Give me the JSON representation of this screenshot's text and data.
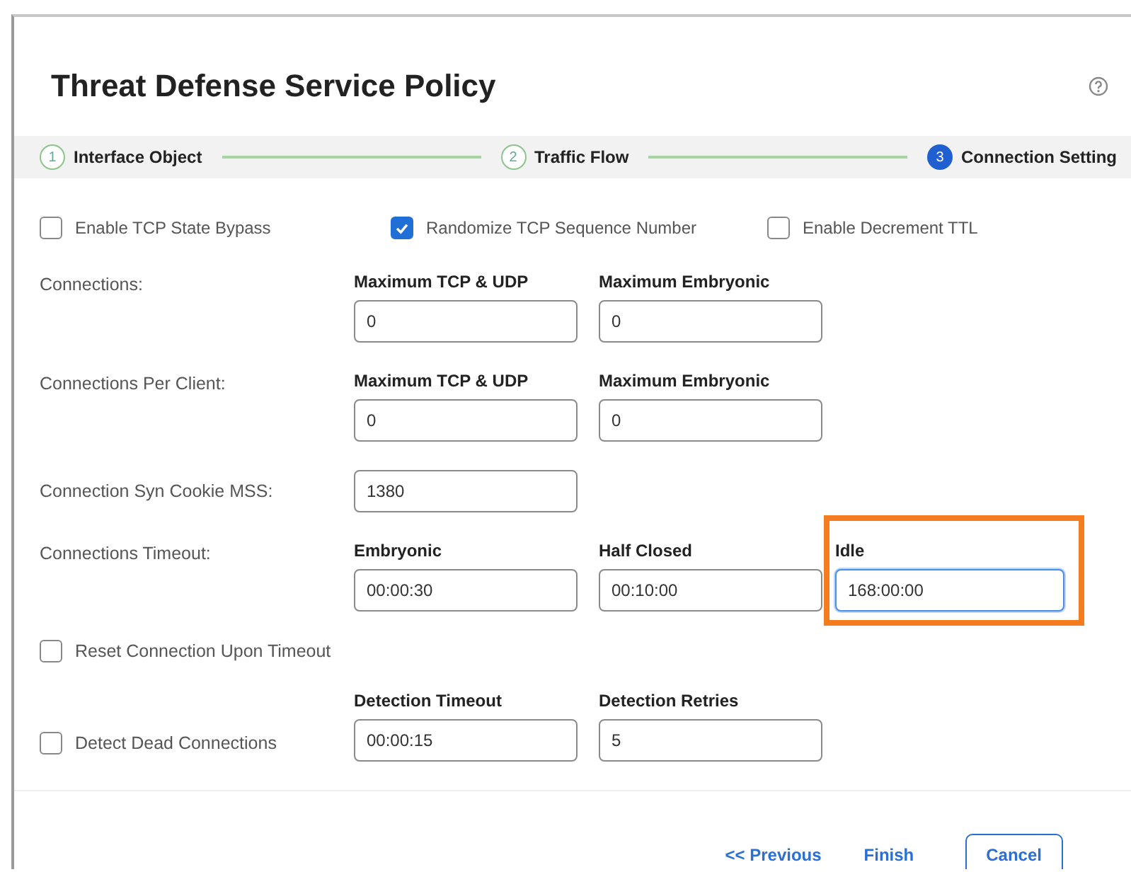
{
  "title": "Threat Defense Service Policy",
  "steps": [
    {
      "number": "1",
      "label": "Interface Object",
      "current": false
    },
    {
      "number": "2",
      "label": "Traffic Flow",
      "current": false
    },
    {
      "number": "3",
      "label": "Connection Setting",
      "current": true
    }
  ],
  "options": [
    {
      "label": "Enable TCP State Bypass",
      "checked": false
    },
    {
      "label": "Randomize TCP Sequence Number",
      "checked": true
    },
    {
      "label": "Enable Decrement TTL",
      "checked": false
    }
  ],
  "rows": [
    {
      "kind": "fields",
      "label": "Connections:",
      "fields": [
        {
          "label": "Maximum TCP & UDP",
          "value": "0",
          "focused": false,
          "highlighted": false
        },
        {
          "label": "Maximum Embryonic",
          "value": "0",
          "focused": false,
          "highlighted": false
        }
      ]
    },
    {
      "kind": "fields",
      "label": "Connections Per Client:",
      "fields": [
        {
          "label": "Maximum TCP & UDP",
          "value": "0",
          "focused": false,
          "highlighted": false
        },
        {
          "label": "Maximum Embryonic",
          "value": "0",
          "focused": false,
          "highlighted": false
        }
      ]
    },
    {
      "kind": "fields",
      "label": "Connection Syn Cookie MSS:",
      "fields": [
        {
          "value": "1380",
          "focused": false,
          "highlighted": false
        }
      ]
    },
    {
      "kind": "fields",
      "label": "Connections Timeout:",
      "fields": [
        {
          "label": "Embryonic",
          "value": "00:00:30",
          "focused": false,
          "highlighted": false
        },
        {
          "label": "Half Closed",
          "value": "00:10:00",
          "focused": false,
          "highlighted": false
        },
        {
          "label": "Idle",
          "value": "168:00:00",
          "focused": true,
          "highlighted": true
        }
      ]
    },
    {
      "kind": "checkbox",
      "label": "Reset Connection Upon Timeout",
      "checked": false
    },
    {
      "kind": "checkbox",
      "label": "Detect Dead Connections",
      "checked": false,
      "fields": [
        {
          "label": "Detection Timeout",
          "value": "00:00:15",
          "focused": false,
          "highlighted": false
        },
        {
          "label": "Detection Retries",
          "value": "5",
          "focused": false,
          "highlighted": false
        }
      ]
    }
  ],
  "buttons": [
    {
      "label": "<< Previous",
      "kind": "link"
    },
    {
      "label": "Finish",
      "kind": "link"
    },
    {
      "label": "Cancel",
      "kind": "outlined"
    }
  ]
}
